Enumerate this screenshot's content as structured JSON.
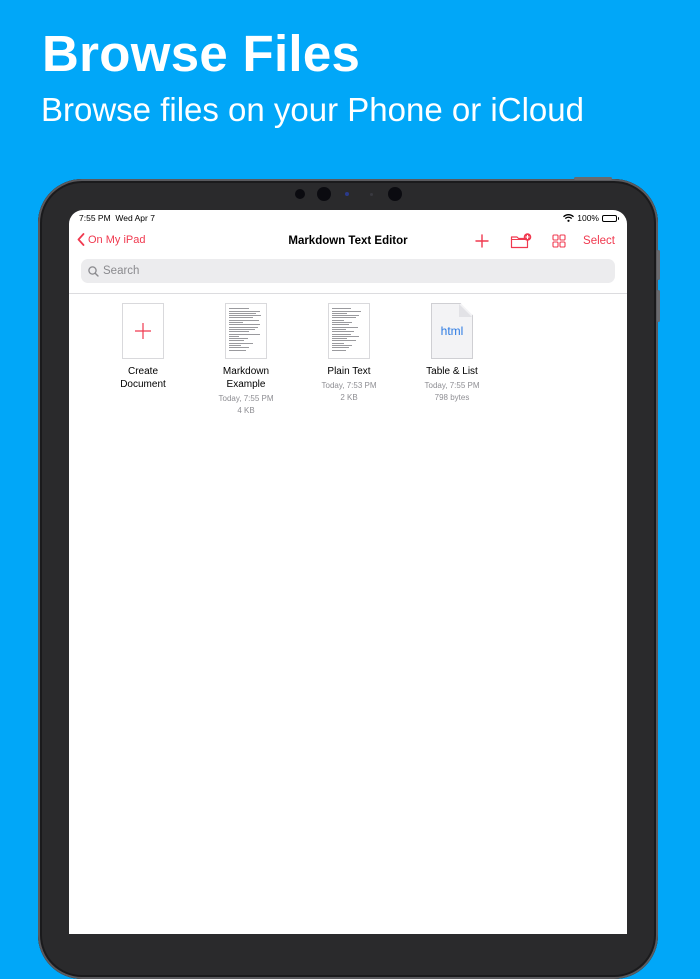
{
  "marketing": {
    "headline": "Browse Files",
    "subheadline": "Browse files on your Phone or iCloud"
  },
  "status_bar": {
    "time": "7:55 PM",
    "date": "Wed Apr 7",
    "battery": "100%"
  },
  "nav": {
    "back_label": "On My iPad",
    "title": "Markdown Text Editor",
    "select_label": "Select"
  },
  "search": {
    "placeholder": "Search"
  },
  "files": [
    {
      "name_line1": "Create",
      "name_line2": "Document",
      "date": "",
      "size": "",
      "kind": "create"
    },
    {
      "name_line1": "Markdown",
      "name_line2": "Example",
      "date": "Today, 7:55 PM",
      "size": "4 KB",
      "kind": "doc"
    },
    {
      "name_line1": "Plain Text",
      "name_line2": "",
      "date": "Today, 7:53 PM",
      "size": "2 KB",
      "kind": "doc"
    },
    {
      "name_line1": "Table & List",
      "name_line2": "",
      "date": "Today, 7:55 PM",
      "size": "798 bytes",
      "kind": "html",
      "thumb_label": "html"
    }
  ],
  "colors": {
    "background": "#01a7f8",
    "accent": "#f0394f",
    "html_label": "#2d7be3"
  },
  "icons": {
    "back": "chevron-left-icon",
    "add": "plus-icon",
    "new_folder": "folder-badge-plus-icon",
    "view_mode": "grid-icon",
    "search": "magnifying-glass-icon",
    "wifi": "wifi-icon",
    "battery": "battery-icon"
  }
}
